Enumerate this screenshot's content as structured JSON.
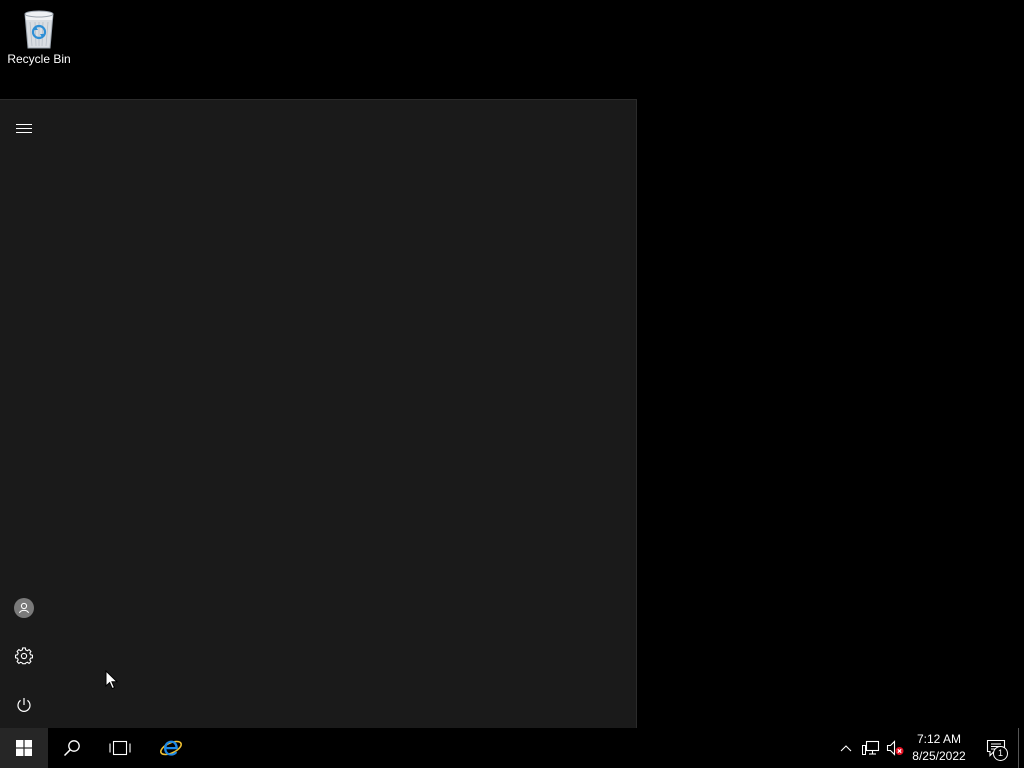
{
  "desktop": {
    "icons": [
      {
        "label": "Recycle Bin",
        "icon": "recycle-bin-icon"
      }
    ]
  },
  "start_menu": {
    "rail": {
      "expand": {
        "icon": "hamburger-menu-icon"
      },
      "user": {
        "icon": "user-account-icon"
      },
      "settings": {
        "icon": "gear-icon"
      },
      "power": {
        "icon": "power-icon"
      }
    }
  },
  "taskbar": {
    "start": {
      "icon": "windows-logo-icon"
    },
    "search": {
      "icon": "search-icon"
    },
    "task_view": {
      "icon": "task-view-icon"
    },
    "pinned": [
      {
        "icon": "internet-explorer-icon"
      }
    ],
    "tray": {
      "chevron": {
        "icon": "chevron-up-icon"
      },
      "network": {
        "icon": "network-icon"
      },
      "volume": {
        "icon": "volume-muted-icon"
      },
      "clock": {
        "time": "7:12 AM",
        "date": "8/25/2022"
      },
      "notifications": {
        "icon": "action-center-icon",
        "count": "1"
      }
    }
  },
  "colors": {
    "desktop_background": "#000000",
    "start_menu_background": "#1a1a1a",
    "taskbar_background": "#000000",
    "start_button_active": "#262626"
  }
}
